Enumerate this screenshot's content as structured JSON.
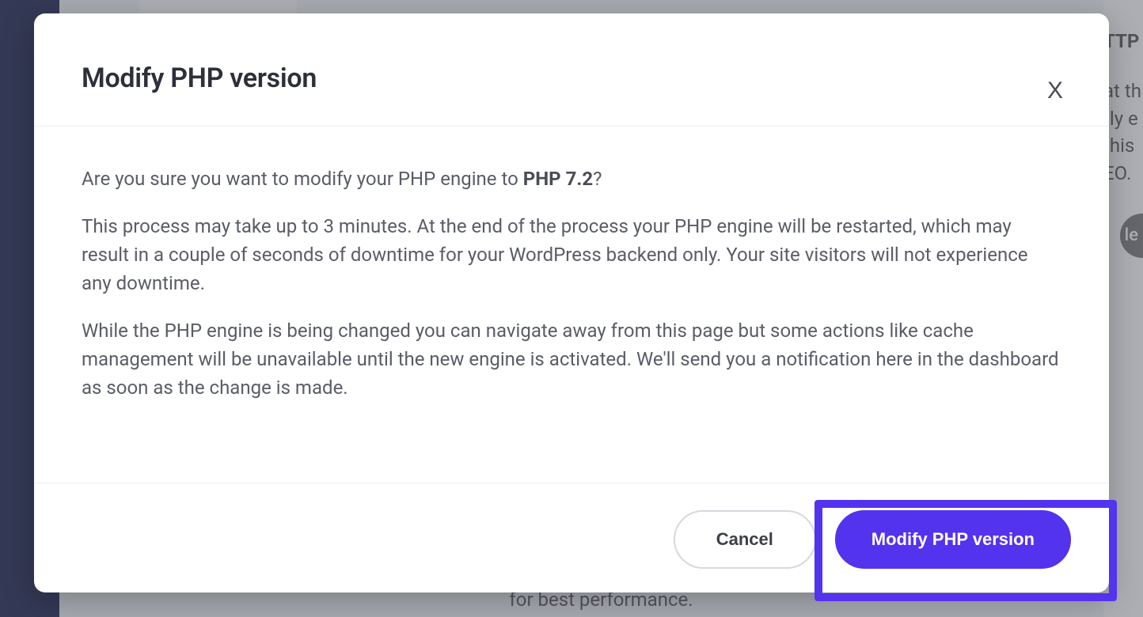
{
  "modal": {
    "title": "Modify PHP version",
    "close_label": "X",
    "body": {
      "confirm_prefix": "Are you sure you want to modify your PHP engine to ",
      "confirm_version": "PHP 7.2",
      "confirm_suffix": "?",
      "paragraph_2": "This process may take up to 3 minutes. At the end of the process your PHP engine will be restarted, which may result in a couple of seconds of downtime for your WordPress backend only. Your site visitors will not experience any downtime.",
      "paragraph_3": "While the PHP engine is being changed you can navigate away from this page but some actions like cache management will be unavailable until the new engine is activated. We'll send you a notification here in the dashboard as soon as the change is made."
    },
    "buttons": {
      "cancel": "Cancel",
      "confirm": "Modify PHP version"
    }
  },
  "background": {
    "right_lines": [
      "TTP",
      "at th",
      "tly e",
      "this",
      "EO."
    ],
    "right_button": "le",
    "bottom_text": "for best performance."
  }
}
